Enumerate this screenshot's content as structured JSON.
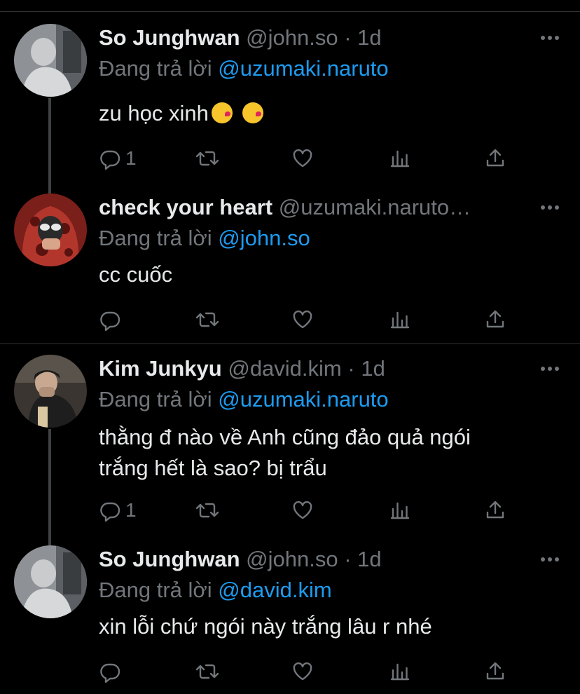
{
  "tweets": [
    {
      "name": "So Junghwan",
      "handle": "@john.so",
      "time": "1d",
      "reply_prefix": "Đang trả lời",
      "reply_to": "@uzumaki.naruto",
      "text": "zu học xinh",
      "emojis": [
        "kissing-face-emoji",
        "kissing-face-emoji"
      ],
      "reply_count": "1"
    },
    {
      "name": "check your heart",
      "handle": "@uzumaki.naruto…",
      "reply_prefix": "Đang trả lời",
      "reply_to": "@john.so",
      "text": "cc cuốc",
      "reply_count": ""
    },
    {
      "name": "Kim Junkyu",
      "handle": "@david.kim",
      "time": "1d",
      "reply_prefix": "Đang trả lời",
      "reply_to": "@uzumaki.naruto",
      "text_lines": [
        "thằng đ nào về Anh cũng đảo quả ngói",
        "trắng hết là sao? bị trẩu"
      ],
      "reply_count": "1"
    },
    {
      "name": "So Junghwan",
      "handle": "@john.so",
      "time": "1d",
      "reply_prefix": "Đang trả lời",
      "reply_to": "@david.kim",
      "text": "xin lỗi chứ ngói này trắng lâu r nhé",
      "reply_count": ""
    }
  ],
  "separator": "·",
  "icons": [
    "reply-icon",
    "retweet-icon",
    "like-icon",
    "analytics-icon",
    "share-icon",
    "more-icon"
  ],
  "colors": {
    "background": "#000000",
    "text": "#e7e9ea",
    "muted": "#71767b",
    "link": "#1d9bf0",
    "divider": "#2f3336"
  }
}
